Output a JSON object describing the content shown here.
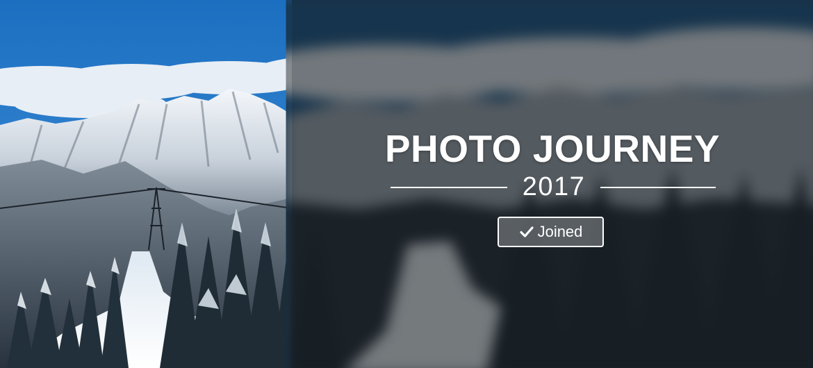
{
  "banner": {
    "title": "PHOTO JOURNEY",
    "year": "2017",
    "joined_button": {
      "label": "Joined",
      "icon": "check-icon"
    },
    "image_description_icon": "mountain-photo"
  },
  "colors": {
    "sky": "#1f78c8",
    "text": "#ffffff",
    "button_fill": "rgba(255,255,255,0.28)"
  }
}
